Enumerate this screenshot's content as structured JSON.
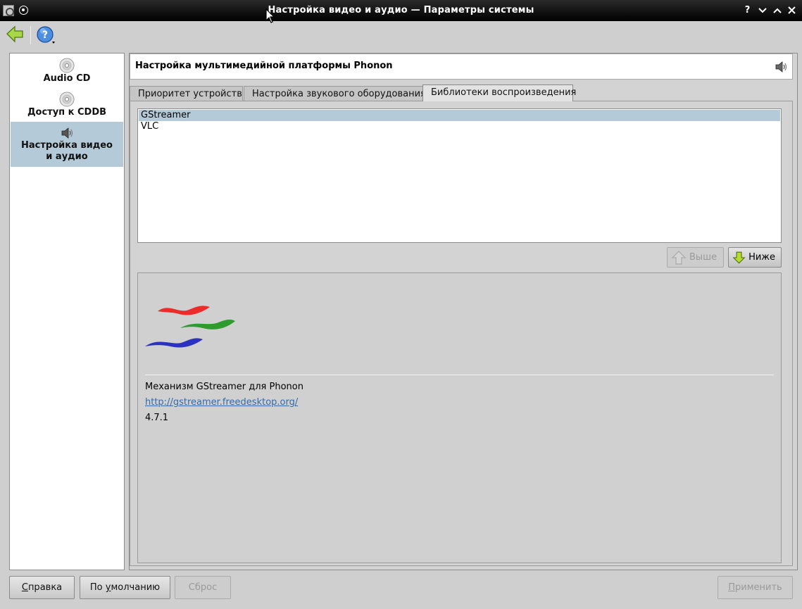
{
  "window": {
    "title": "Настройка видео и аудио — Параметры системы",
    "help_label": "?"
  },
  "sidebar": {
    "items": [
      {
        "label": "Audio CD",
        "icon": "cd-icon",
        "selected": false
      },
      {
        "label": "Доступ к CDDB",
        "icon": "cd-icon",
        "selected": false
      },
      {
        "label_line1": "Настройка видео",
        "label_line2": "и аудио",
        "icon": "speaker-icon",
        "selected": true
      }
    ]
  },
  "header": {
    "title": "Настройка мультимедийной платформы Phonon"
  },
  "tabs": [
    {
      "label": "Приоритет устройств",
      "active": false
    },
    {
      "label": "Настройка звукового оборудования",
      "active": false
    },
    {
      "label": "Библиотеки воспроизведения",
      "active": true
    }
  ],
  "backends": [
    {
      "name": "GStreamer",
      "selected": true
    },
    {
      "name": "VLC",
      "selected": false
    }
  ],
  "move_buttons": {
    "up_label": "Выше",
    "up_enabled": false,
    "down_label": "Ниже",
    "down_enabled": true
  },
  "backend_info": {
    "name": "Механизм GStreamer для Phonon",
    "url": "http://gstreamer.freedesktop.org/",
    "version": "4.7.1"
  },
  "bottom_buttons": {
    "help_mnemonic": "С",
    "help_rest": "правка",
    "defaults_pre": "По ",
    "defaults_mnemonic": "у",
    "defaults_rest": "молчанию",
    "reset_label": "Сброс",
    "apply_mnemonic": "П",
    "apply_rest": "рименить"
  },
  "colors": {
    "selection": "#b5cad9",
    "link": "#3569a8",
    "titlebar": "#000000"
  }
}
